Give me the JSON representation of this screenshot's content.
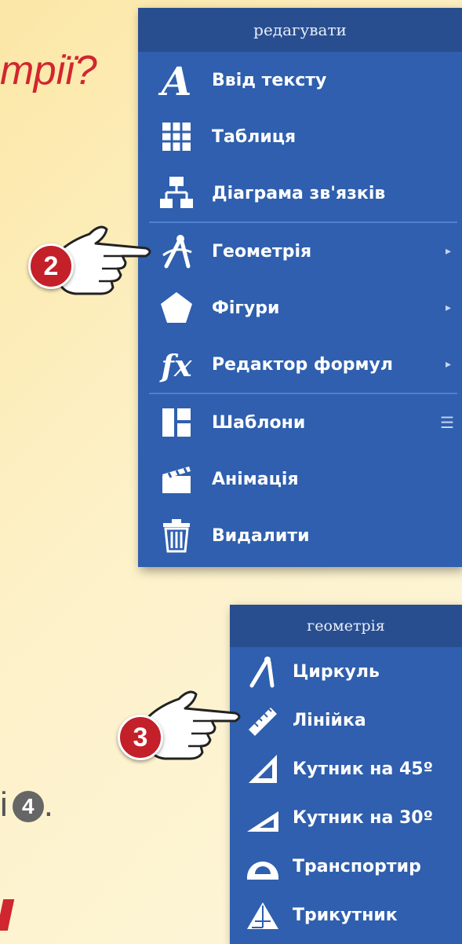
{
  "background": {
    "heading_fragment": "трії?",
    "step4_text": "і",
    "step4_number": "4",
    "step4_period": "."
  },
  "edit_panel": {
    "title": "редагувати",
    "items": [
      {
        "label": "Ввід тексту",
        "icon": "text-a-icon"
      },
      {
        "label": "Таблиця",
        "icon": "table-icon"
      },
      {
        "label": "Діаграма зв'язків",
        "icon": "diagram-icon"
      },
      {
        "label": "Геометрія",
        "icon": "compass-icon",
        "submenu": "▸"
      },
      {
        "label": "Фігури",
        "icon": "pentagon-icon",
        "submenu": "▸"
      },
      {
        "label": "Редактор формул",
        "icon": "fx-icon",
        "submenu": "▸"
      },
      {
        "label": "Шаблони",
        "icon": "templates-icon",
        "menu": "☰"
      },
      {
        "label": "Анімація",
        "icon": "clapperboard-icon"
      },
      {
        "label": "Видалити",
        "icon": "trash-icon"
      }
    ]
  },
  "geometry_panel": {
    "title": "геометрія",
    "items": [
      {
        "label": "Циркуль",
        "icon": "compass-icon"
      },
      {
        "label": "Лінійка",
        "icon": "ruler-icon"
      },
      {
        "label": "Кутник на 45º",
        "icon": "set-square-45-icon"
      },
      {
        "label": "Кутник на 30º",
        "icon": "set-square-30-icon"
      },
      {
        "label": "Транспортир",
        "icon": "protractor-icon"
      },
      {
        "label": "Трикутник",
        "icon": "triangle-icon"
      }
    ]
  },
  "callouts": [
    {
      "number": "2"
    },
    {
      "number": "3"
    }
  ],
  "colors": {
    "panel": "#2f5fae",
    "panel_header": "#284e8f",
    "badge": "#c4202a",
    "accent_text": "#d0262f"
  }
}
